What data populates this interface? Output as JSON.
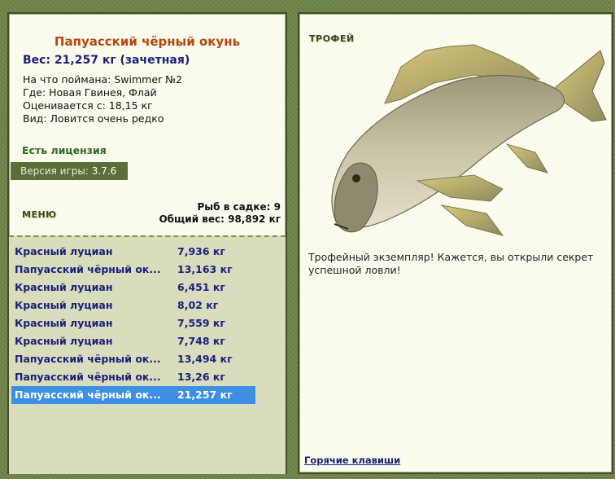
{
  "fish": {
    "title": "Папуасский чёрный окунь",
    "weight": "Вес: 21,257 кг (зачетная)",
    "caught_with": "На что поймана: Swimmer №2",
    "location": "Где: Новая Гвинея, Флай",
    "rated_from": "Оценивается с: 18,15 кг",
    "kind": "Вид: Ловится очень редко"
  },
  "license": "Есть лицензия",
  "version": {
    "label": "Версия игры:",
    "value": "3.7.6"
  },
  "menu_label": "МЕНЮ",
  "catch_summary": {
    "count": "Рыб в садке: 9",
    "total": "Общий вес: 98,892 кг"
  },
  "catches": [
    {
      "name": "Красный луциан",
      "weight": "7,936 кг"
    },
    {
      "name": "Папуасский чёрный ок...",
      "weight": "13,163 кг"
    },
    {
      "name": "Красный луциан",
      "weight": "6,451 кг"
    },
    {
      "name": "Красный луциан",
      "weight": "8,02 кг"
    },
    {
      "name": "Красный луциан",
      "weight": "7,559 кг"
    },
    {
      "name": "Красный луциан",
      "weight": "7,748 кг"
    },
    {
      "name": "Папуасский чёрный ок...",
      "weight": "13,494 кг"
    },
    {
      "name": "Папуасский чёрный ок...",
      "weight": "13,26 кг"
    },
    {
      "name": "Папуасский чёрный ок...",
      "weight": "21,257 кг"
    }
  ],
  "selected_index": 8,
  "trophy": {
    "label": "ТРОФЕЙ",
    "text": "Трофейный экземпляр! Кажется, вы открыли секрет успешной ловли!"
  },
  "hotkeys": "Горячие клавиши",
  "colors": {
    "frame": "#6e8349",
    "panel": "#fcfcee",
    "title": "#b5460f",
    "link": "#1a1f7a",
    "selection": "#3d8fe6",
    "license": "#2b6b1c"
  }
}
